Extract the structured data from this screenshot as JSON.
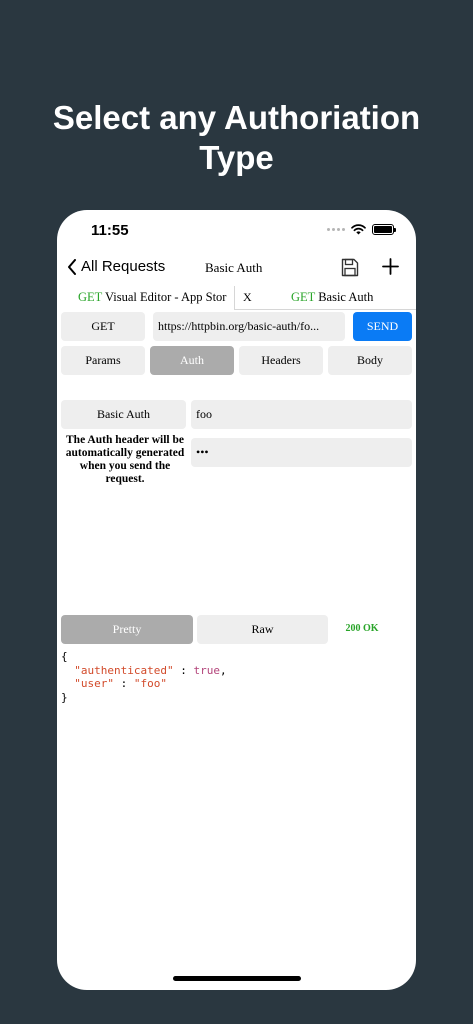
{
  "headline": {
    "line1": "Select any Authoriation",
    "line2": "Type"
  },
  "status_bar": {
    "time": "11:55"
  },
  "nav": {
    "back_label": "All Requests",
    "title": "Basic Auth"
  },
  "request_tabs": [
    {
      "method": "GET",
      "label": "Visual Editor - App Stor"
    },
    {
      "method": "GET",
      "label": "Basic Auth"
    }
  ],
  "tab_close_label": "X",
  "request": {
    "method": "GET",
    "url": "https://httpbin.org/basic-auth/fo...",
    "send_label": "SEND"
  },
  "section_tabs": {
    "params": "Params",
    "auth": "Auth",
    "headers": "Headers",
    "body": "Body"
  },
  "auth": {
    "type_label": "Basic Auth",
    "username": "foo",
    "password": "•••",
    "note": "The Auth header will be automatically generated when you send the request."
  },
  "response": {
    "pretty_label": "Pretty",
    "raw_label": "Raw",
    "status": "200 OK",
    "json": {
      "open": "{",
      "key1": "\"authenticated\"",
      "sep1": " : ",
      "val1": "true",
      "comma": ",",
      "key2": "\"user\"",
      "sep2": " : ",
      "val2": "\"foo\"",
      "close": "}"
    }
  },
  "colors": {
    "background": "#2a3740",
    "send": "#0a7bf5",
    "method": "#2aa52a",
    "selected_tab": "#ababab"
  },
  "icons": [
    "chevron-left-icon",
    "floppy-disk-icon",
    "plus-icon",
    "wifi-icon",
    "battery-icon",
    "signal-icon"
  ]
}
